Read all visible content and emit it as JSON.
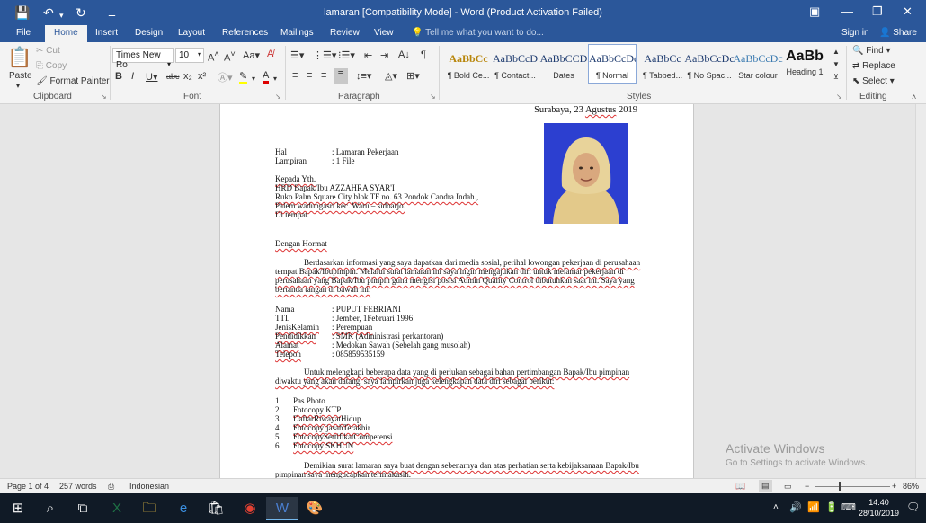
{
  "app": {
    "window_title": "lamaran [Compatibility Mode] - Word (Product Activation Failed)",
    "sign_in": "Sign in",
    "share": "Share"
  },
  "tabs": [
    "File",
    "Home",
    "Insert",
    "Design",
    "Layout",
    "References",
    "Mailings",
    "Review",
    "View"
  ],
  "tell_me": "Tell me what you want to do...",
  "ribbon": {
    "clipboard": {
      "paste": "Paste",
      "cut": "Cut",
      "copy": "Copy",
      "format_painter": "Format Painter",
      "label": "Clipboard"
    },
    "font": {
      "name": "Times New Ro",
      "size": "10",
      "label": "Font"
    },
    "paragraph": {
      "label": "Paragraph"
    },
    "styles": {
      "label": "Styles",
      "items": [
        {
          "preview": "AaBbCc",
          "name": "¶ Bold Ce..."
        },
        {
          "preview": "AaBbCcD",
          "name": "¶ Contact..."
        },
        {
          "preview": "AaBbCCD",
          "name": "Dates"
        },
        {
          "preview": "AaBbCcDc",
          "name": "¶ Normal"
        },
        {
          "preview": "AaBbCc",
          "name": "¶ Tabbed..."
        },
        {
          "preview": "AaBbCcDc",
          "name": "¶ No Spac..."
        },
        {
          "preview": "AaBbCcDc",
          "name": "Star colour"
        },
        {
          "preview": "AaBb",
          "name": "Heading 1"
        }
      ]
    },
    "editing": {
      "find": "Find",
      "replace": "Replace",
      "select": "Select",
      "label": "Editing"
    }
  },
  "document": {
    "date_line": "Surabaya, 23 Agustus 2019",
    "hal_label": "Hal",
    "hal_value": ": Lamaran Pekerjaan",
    "lampiran_label": "Lampiran",
    "lampiran_value": ": 1 File",
    "addr1": "Kepada Yth.",
    "addr2": "HRD Bapak/Ibu AZZAHRA SYAR'I",
    "addr3": "Ruko Palm Square City blok TF no. 63 Pondok Candra Indah.,",
    "addr4": "Palem wadungasri kec. Waru – sidoarjo.",
    "addr5": "Di tempat.",
    "greeting": "Dengan Hormat",
    "para1_l1": "Berdasarkan informasi yang saya dapatkan dari media sosial, perihal lowongan pekerjaan di perusahaan",
    "para1_l2": "tempat Bapak/Ibupimpin. Melalui surat lamaran ini saya ingin mengajukan diri untuk melamar pekerjaan di",
    "para1_l3": "perusahaan yang Bapak/Ibu pimpin guna mengisi posisi Admin Quality Control dibutuhkan saat ini. Saya yang",
    "para1_l4": "bertanda tangan di bawah ini:",
    "fields": [
      {
        "label": "Nama",
        "value": ": PUPUT FEBRIANI"
      },
      {
        "label": "TTL",
        "value": ": Jember, 1Februari 1996"
      },
      {
        "label": "JenisKelamin",
        "value": ": Perempuan"
      },
      {
        "label": "Pendidikkan",
        "value": ": SMK (Administrasi perkantoran)"
      },
      {
        "label": "Alamat",
        "value": ": Medokan Sawah (Sebelah gang musolah)"
      },
      {
        "label": "Telepon",
        "value": ": 085859535159"
      }
    ],
    "para2_l1": "Untuk melengkapi beberapa data yang di perlukan sebagai bahan pertimbangan Bapak/Ibu pimpinan",
    "para2_l2": "diwaktu yang akan datang, saya lampirkan juga kelengkapan data diri sebagai berikut:",
    "list": [
      {
        "n": "1.",
        "t": "Pas Photo"
      },
      {
        "n": "2.",
        "t": "Fotocopy KTP"
      },
      {
        "n": "3.",
        "t": "DaftarRiwayatHidup"
      },
      {
        "n": "4.",
        "t": "FotocopyIjasahTerakhir"
      },
      {
        "n": "5.",
        "t": "FotocopySertifikatCompetensi"
      },
      {
        "n": "6.",
        "t": "Fotocopy SKHUN"
      }
    ],
    "para3_l1": "Demikian surat lamaran saya buat dengan sebenarnya dan atas perhatian serta kebijaksanaan Bapak/Ibu",
    "para3_l2": "pimpinan saya mengucapkan terimakasih."
  },
  "watermark": {
    "line1": "Activate Windows",
    "line2": "Go to Settings to activate Windows."
  },
  "status": {
    "page": "Page 1 of 4",
    "words": "257 words",
    "language": "Indonesian",
    "zoom": "86%"
  },
  "taskbar": {
    "time": "14.40",
    "date": "28/10/2019"
  },
  "colors": {
    "word_blue": "#2b579a",
    "taskbar": "#101a26",
    "photo_bg": "#2c3fd0"
  }
}
